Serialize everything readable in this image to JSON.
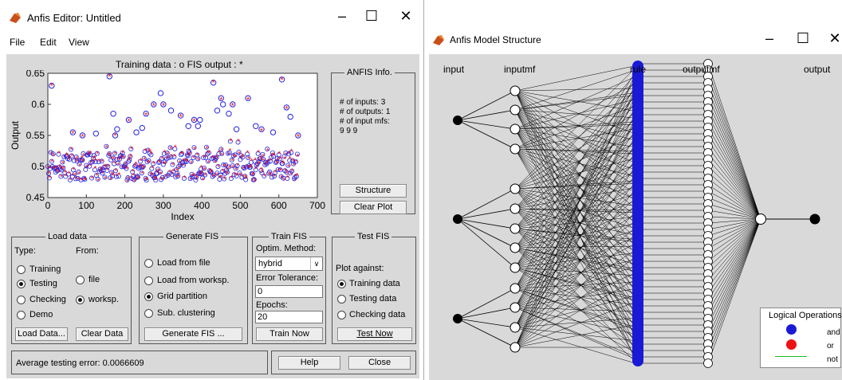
{
  "editor": {
    "title": "Anfis Editor: Untitled",
    "menu": [
      "File",
      "Edit",
      "View"
    ],
    "plot_title": "Training data : o   FIS output : *",
    "ylabel": "Output",
    "xlabel": "Index",
    "xticks": [
      "0",
      "100",
      "200",
      "300",
      "400",
      "500",
      "600",
      "700"
    ],
    "yticks": [
      "0.65",
      "0.6",
      "0.55",
      "0.5",
      "0.45"
    ],
    "info": {
      "title": "ANFIS Info.",
      "inputs": "# of inputs: 3",
      "outputs": "# of outputs: 1",
      "mfs_label": "# of input mfs:",
      "mfs_value": "9 9 9"
    },
    "structure_btn": "Structure",
    "clear_plot_btn": "Clear Plot",
    "load": {
      "title": "Load data",
      "type_label": "Type:",
      "from_label": "From:",
      "types": [
        "Training",
        "Testing",
        "Checking",
        "Demo"
      ],
      "from": [
        "file",
        "worksp."
      ],
      "load_btn": "Load Data...",
      "clear_btn": "Clear Data"
    },
    "gen": {
      "title": "Generate FIS",
      "options": [
        "Load from file",
        "Load from worksp.",
        "Grid partition",
        "Sub. clustering"
      ],
      "btn": "Generate FIS ..."
    },
    "train": {
      "title": "Train FIS",
      "method_label": "Optim. Method:",
      "method": "hybrid",
      "tol_label": "Error Tolerance:",
      "tol": "0",
      "epochs_label": "Epochs:",
      "epochs": "20",
      "btn": "Train Now"
    },
    "test": {
      "title": "Test FIS",
      "against": "Plot against:",
      "options": [
        "Training data",
        "Testing data",
        "Checking data"
      ],
      "btn": "Test Now"
    },
    "status": "Average testing error: 0.0066609",
    "help_btn": "Help",
    "close_btn": "Close",
    "colors": {
      "training": "#2222dd",
      "output": "#ee1111"
    }
  },
  "structure": {
    "title": "Anfis Model Structure",
    "labels": [
      "input",
      "inputmf",
      "rule",
      "outputmf",
      "output"
    ],
    "legend_title": "Logical Operations",
    "legend": [
      "and",
      "or",
      "not"
    ],
    "colors": {
      "and": "#1a1ad6",
      "or": "#ee1111",
      "not": "#22bb22",
      "rule_bar": "#1a1ad6"
    }
  },
  "chart_data": {
    "type": "scatter",
    "title": "Training data : o   FIS output : *",
    "xlabel": "Index",
    "ylabel": "Output",
    "xlim": [
      0,
      700
    ],
    "ylim": [
      0.45,
      0.65
    ],
    "series": [
      {
        "name": "Training data",
        "marker": "o",
        "points": [
          [
            10,
            0.63
          ],
          [
            65,
            0.555
          ],
          [
            90,
            0.55
          ],
          [
            125,
            0.553
          ],
          [
            160,
            0.645
          ],
          [
            170,
            0.585
          ],
          [
            175,
            0.55
          ],
          [
            180,
            0.56
          ],
          [
            210,
            0.575
          ],
          [
            230,
            0.555
          ],
          [
            245,
            0.562
          ],
          [
            255,
            0.585
          ],
          [
            275,
            0.6
          ],
          [
            293,
            0.618
          ],
          [
            300,
            0.6
          ],
          [
            320,
            0.59
          ],
          [
            345,
            0.582
          ],
          [
            365,
            0.565
          ],
          [
            380,
            0.575
          ],
          [
            390,
            0.565
          ],
          [
            395,
            0.575
          ],
          [
            430,
            0.635
          ],
          [
            440,
            0.59
          ],
          [
            450,
            0.61
          ],
          [
            455,
            0.6
          ],
          [
            470,
            0.585
          ],
          [
            480,
            0.6
          ],
          [
            490,
            0.56
          ],
          [
            520,
            0.61
          ],
          [
            540,
            0.565
          ],
          [
            555,
            0.56
          ],
          [
            585,
            0.555
          ],
          [
            608,
            0.64
          ],
          [
            620,
            0.595
          ],
          [
            630,
            0.58
          ],
          [
            650,
            0.55
          ]
        ]
      },
      {
        "name": "FIS output",
        "marker": "*",
        "points": [
          [
            10,
            0.63
          ],
          [
            65,
            0.553
          ],
          [
            90,
            0.548
          ],
          [
            160,
            0.645
          ],
          [
            175,
            0.55
          ],
          [
            210,
            0.573
          ],
          [
            255,
            0.583
          ],
          [
            275,
            0.598
          ],
          [
            300,
            0.598
          ],
          [
            345,
            0.58
          ],
          [
            380,
            0.573
          ],
          [
            430,
            0.635
          ],
          [
            450,
            0.608
          ],
          [
            480,
            0.598
          ],
          [
            520,
            0.608
          ],
          [
            555,
            0.558
          ],
          [
            608,
            0.64
          ],
          [
            620,
            0.593
          ],
          [
            650,
            0.548
          ]
        ]
      }
    ]
  }
}
